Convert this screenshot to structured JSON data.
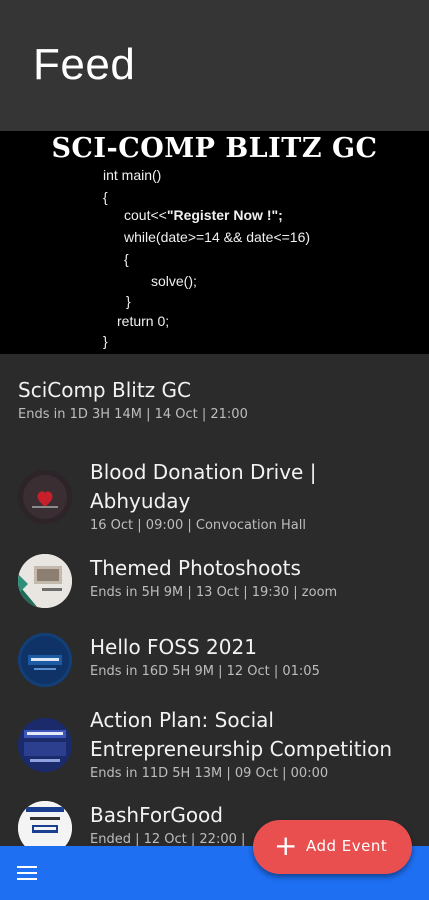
{
  "app_bar": {
    "title": "Feed"
  },
  "banner": {
    "title": "SCI-COMP BLITZ GC",
    "code": [
      "int main()",
      "{",
      "cout<<\"Register Now !\";",
      "while(date>=14 && date<=16)",
      "{",
      "solve();",
      "}",
      "return 0;",
      "}"
    ]
  },
  "featured": {
    "title": "SciComp Blitz GC",
    "subtitle": "Ends in 1D 3H 14M | 14 Oct | 21:00"
  },
  "events": [
    {
      "title": "Blood Donation Drive | Abhyuday",
      "subtitle": "16 Oct | 09:00 | Convocation Hall",
      "icon": "blood-drop"
    },
    {
      "title": "Themed Photoshoots",
      "subtitle": "Ends in 5H 9M | 13 Oct | 19:30 | zoom",
      "icon": "photo"
    },
    {
      "title": "Hello FOSS 2021",
      "subtitle": "Ends in 16D 5H 9M | 12 Oct | 01:05",
      "icon": "foss"
    },
    {
      "title": "Action Plan: Social Entrepreneurship Competition",
      "subtitle": "Ends in 11D 5H 13M | 09 Oct | 00:00",
      "icon": "action-plan"
    },
    {
      "title": "BashForGood",
      "subtitle": "Ended | 12 Oct | 22:00 |",
      "icon": "bash"
    }
  ],
  "fab": {
    "label": "Add Event"
  },
  "colors": {
    "bottom_bar": "#1e6ff2",
    "fab": "#ea4f4f",
    "app_bar": "#353535",
    "background": "#2b2b2b"
  }
}
